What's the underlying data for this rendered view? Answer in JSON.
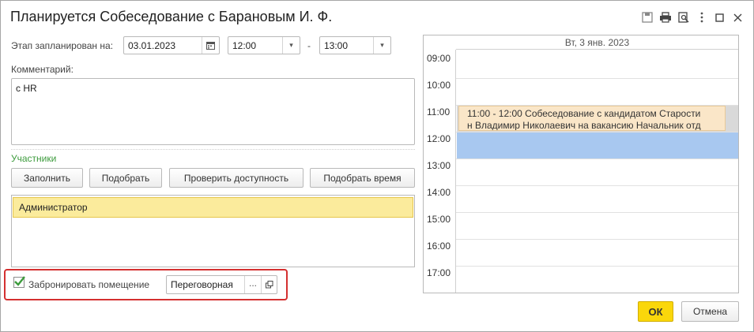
{
  "window": {
    "title": "Планируется Собеседование с Барановым И. Ф.",
    "icons": [
      "save-icon",
      "print-icon",
      "preview-icon",
      "more-icon",
      "maximize-icon",
      "close-icon"
    ]
  },
  "schedule": {
    "label": "Этап запланирован на:",
    "date": "03.01.2023",
    "time_from": "12:00",
    "dash": "-",
    "time_to": "13:00"
  },
  "comment": {
    "label": "Комментарий:",
    "value": "с HR"
  },
  "participants": {
    "section_title": "Участники",
    "buttons": [
      "Заполнить",
      "Подобрать",
      "Проверить доступность",
      "Подобрать время"
    ],
    "items": [
      "Администратор"
    ]
  },
  "booking": {
    "checkbox_label": "Забронировать помещение",
    "checked": true,
    "room": "Переговорная",
    "ellipsis": "..."
  },
  "calendar": {
    "day_header": "Вт, 3 янв. 2023",
    "hours": [
      "09:00",
      "10:00",
      "11:00",
      "12:00",
      "13:00",
      "14:00",
      "15:00",
      "16:00",
      "17:00"
    ],
    "event_line1": "11:00 - 12:00 Собеседование с кандидатом Старости",
    "event_line2": "н Владимир Николаевич на вакансию Начальник отд",
    "colors": {
      "event": "#fae6c8",
      "selection": "#a8c8f0",
      "busy": "#d9d9d9"
    }
  },
  "footer": {
    "ok_label": "ОК",
    "cancel_label": "Отмена"
  },
  "colors": {
    "accent": "#fad70b",
    "section": "#3c9b3c",
    "highlight_frame": "#d43030"
  }
}
